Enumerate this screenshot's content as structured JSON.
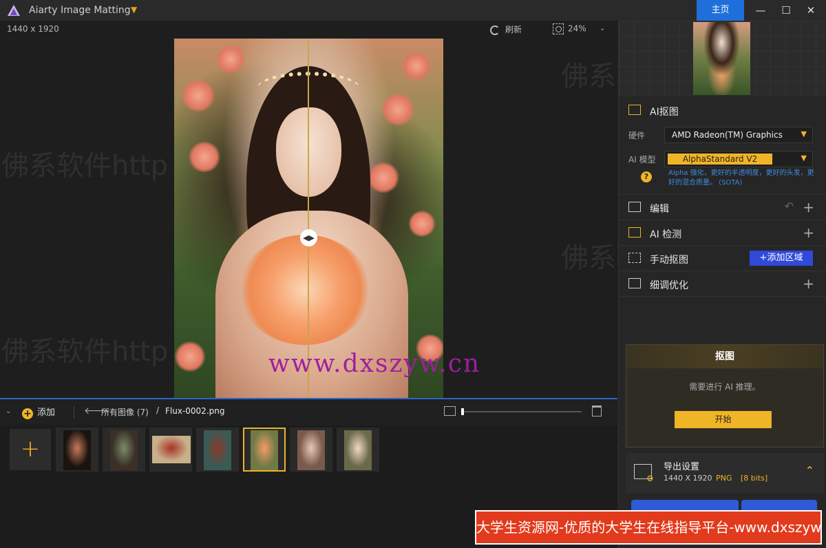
{
  "app": {
    "title": "Aiarty Image Matting",
    "home_label": "主页"
  },
  "canvas": {
    "dimensions": "1440 x 1920",
    "refresh_label": "刷新",
    "zoom_level": "24%"
  },
  "filmstrip": {
    "add_label": "添加",
    "all_images_label": "所有图像 (7)",
    "crumb_separator": "/",
    "current_file": "Flux-0002.png",
    "thumb_size_fraction": 0.0,
    "thumbnails": [
      {
        "name": "jellyfish",
        "color": "#1a1410",
        "accent": "#c97a5a"
      },
      {
        "name": "branches",
        "color": "#3b3026",
        "accent": "#7a8a6a"
      },
      {
        "name": "bicycle",
        "color": "#c9b08a",
        "accent": "#a8322a"
      },
      {
        "name": "forest-woman",
        "color": "#3a5a56",
        "accent": "#8a3a2a"
      },
      {
        "name": "flower-girl",
        "color": "#6f7a45",
        "accent": "#f39a68",
        "selected": true
      },
      {
        "name": "woman-portrait-a",
        "color": "#7a5a4a",
        "accent": "#e8c8b8"
      },
      {
        "name": "woman-portrait-b",
        "color": "#6a6a4a",
        "accent": "#f2d6c8"
      }
    ]
  },
  "panel": {
    "ai_matting": {
      "title": "AI抠图",
      "hardware_label": "硬件",
      "hardware_value": "AMD Radeon(TM) Graphics",
      "model_label": "AI 模型",
      "model_value": "AlphaStandard  V2",
      "model_description": "Alpha 强化，更好的半透明度，更好的头发，更好的混合质量。  (SOTA)"
    },
    "edit_title": "编辑",
    "detect_title": "AI 检测",
    "manual_title": "手动抠图",
    "add_region_label": "添加区域",
    "refine_title": "细调优化",
    "matting_card": {
      "title": "抠图",
      "note": "需要进行 AI 推理。",
      "start_label": "开始"
    },
    "export": {
      "title": "导出设置",
      "dims": "1440 X 1920",
      "format": "PNG",
      "bits": "[8 bits]"
    }
  },
  "watermarks": {
    "foxirj_a": "佛系软件https://fox",
    "foxirj_b": "佛系软件http",
    "foxirj_c": "佛系软件https://foxirj.com",
    "site": "www.dxszyw.cn",
    "banner": "大学生资源网-优质的大学生在线指导平台-www.dxszyw.cn"
  },
  "colors": {
    "accent": "#f0b427",
    "primary_blue": "#1e6fd9",
    "add_region_blue": "#3049d8",
    "banner_red": "#e23a1c"
  }
}
